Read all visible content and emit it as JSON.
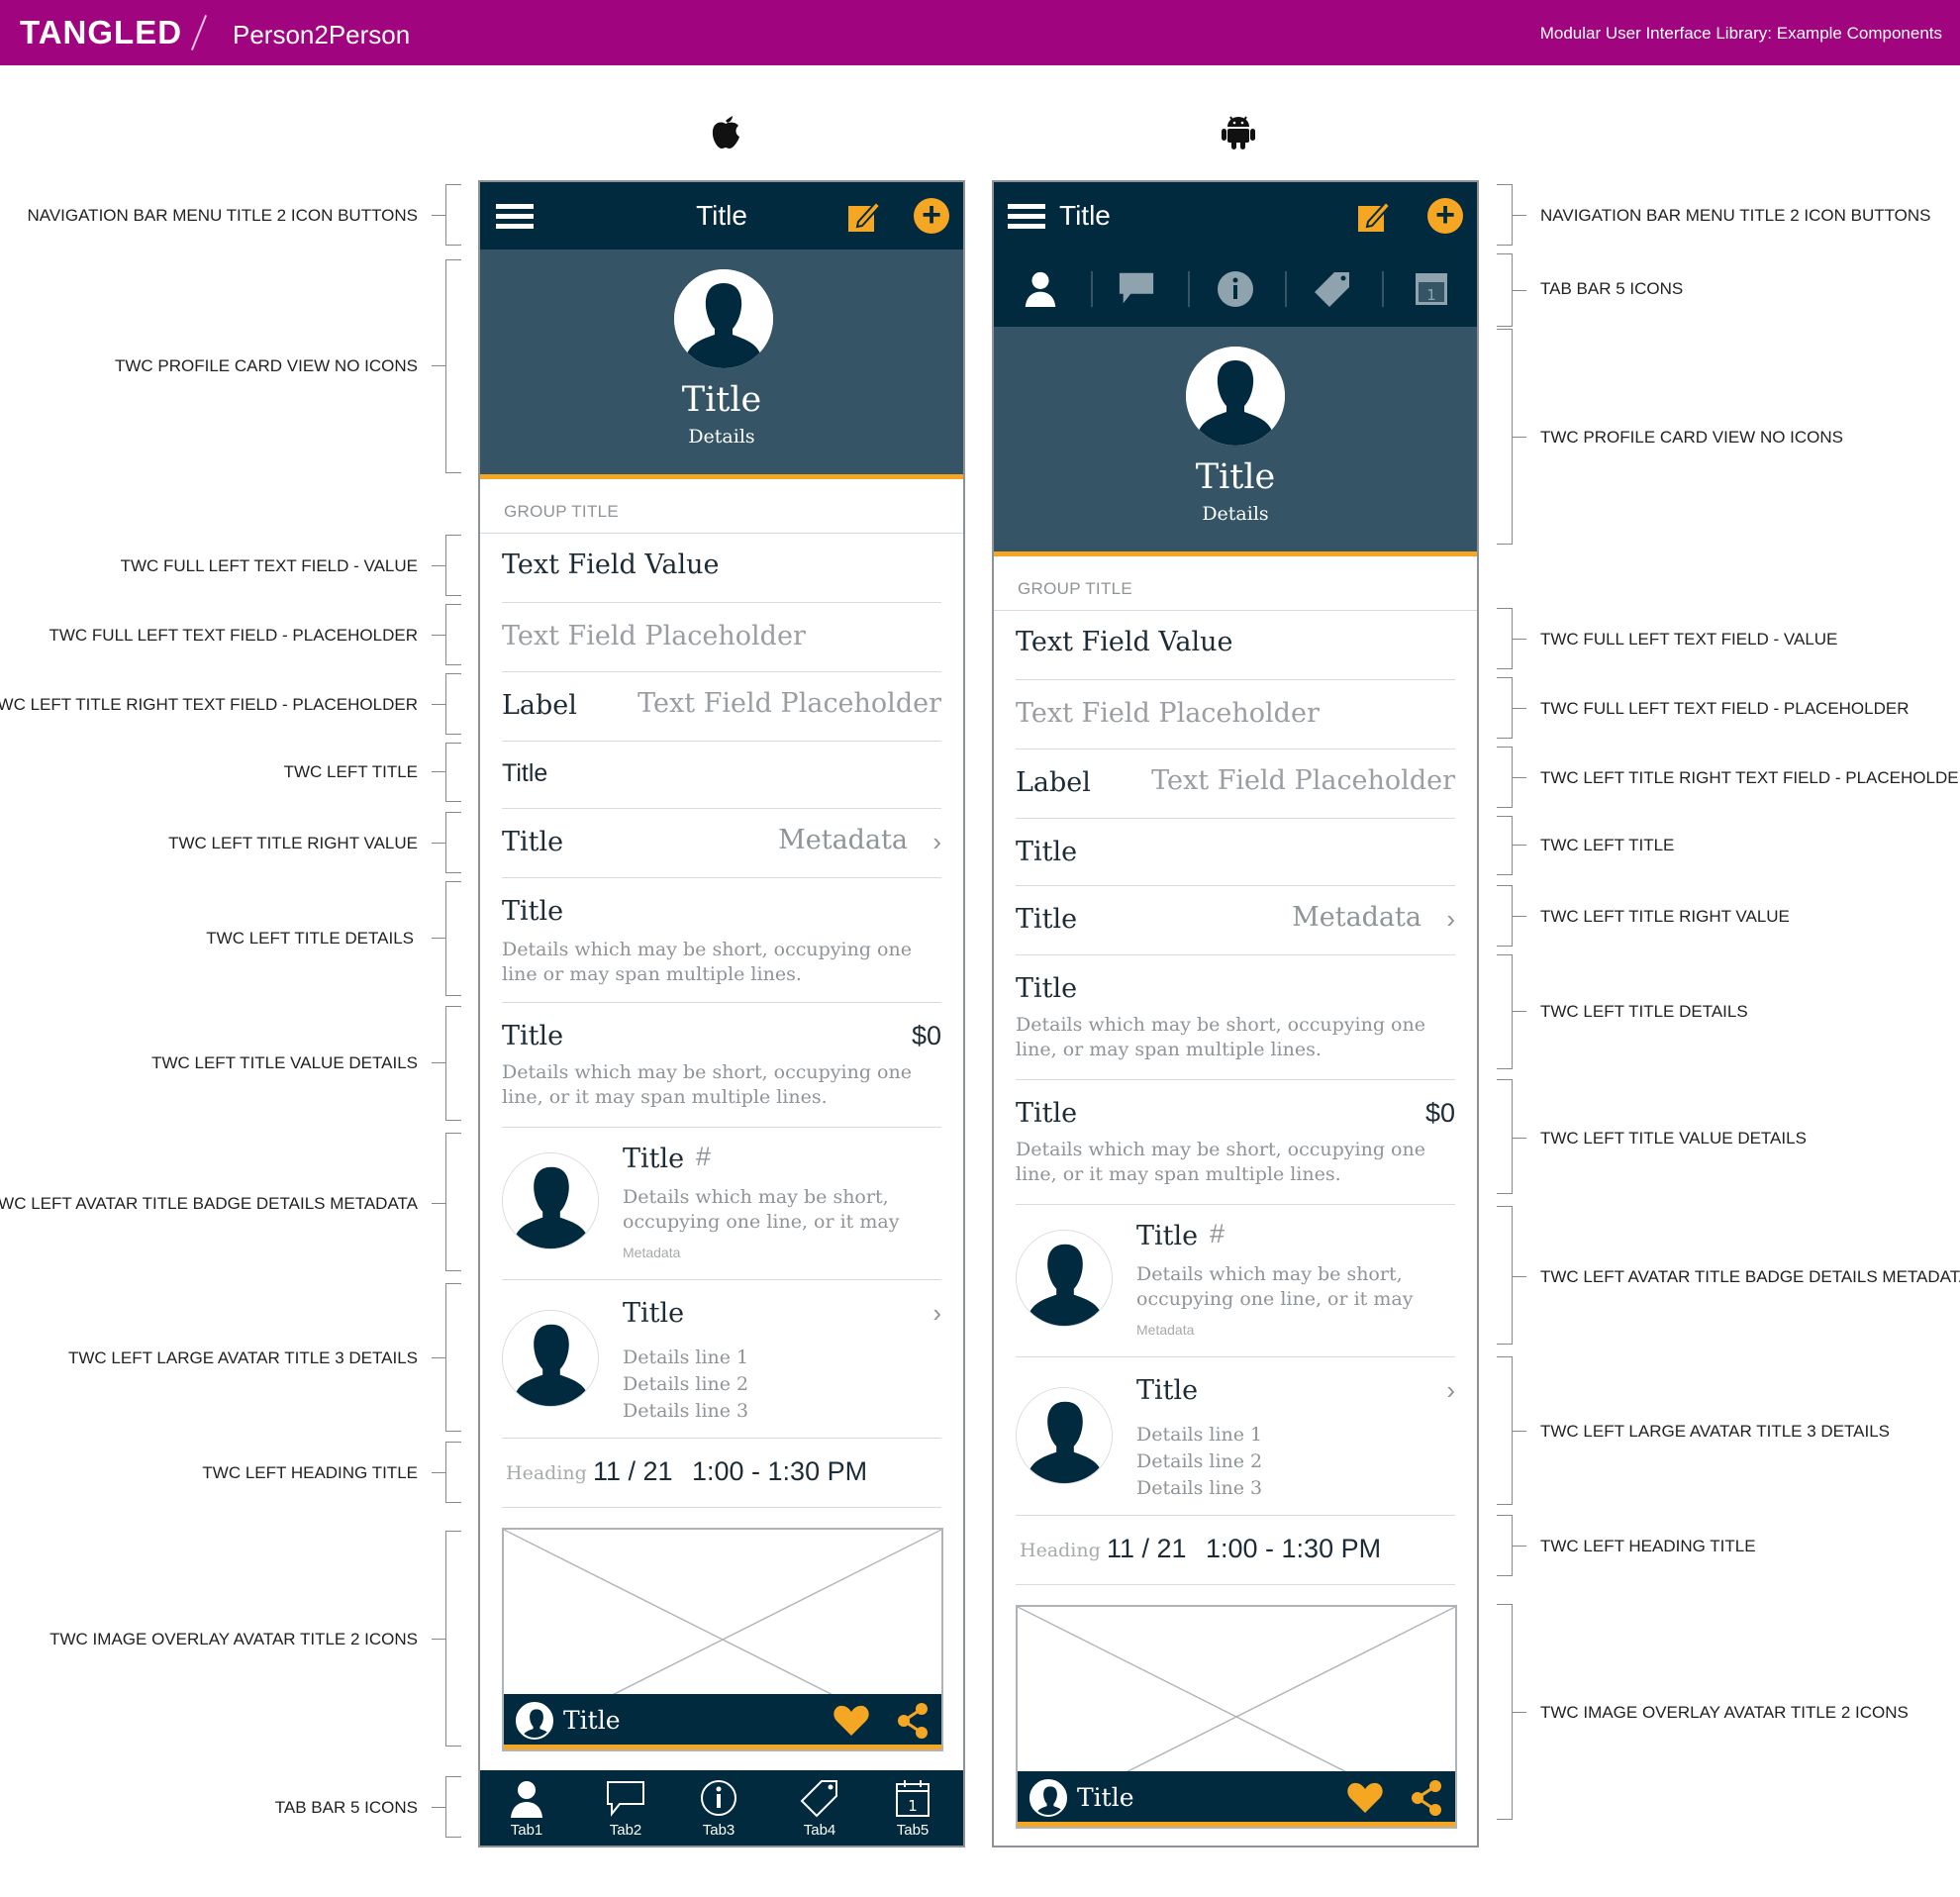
{
  "header": {
    "brand": "TANGLED",
    "product": "Person2Person",
    "library_title": "Modular User Interface Library: Example Components",
    "background": "#a0047e"
  },
  "platforms": {
    "ios_icon": "apple-icon",
    "android_icon": "android-icon"
  },
  "colors": {
    "navy": "#022a3e",
    "slate": "#355566",
    "accent": "#f5a623",
    "brand": "#a0047e"
  },
  "ios": {
    "nav_title": "Title",
    "profile_title": "Title",
    "profile_details": "Details",
    "group_title": "GROUP TITLE",
    "text_field_value": "Text Field Value",
    "text_field_placeholder": "Text Field Placeholder",
    "label": "Label",
    "label_placeholder": "Text Field Placeholder",
    "left_title": "Title",
    "rv_title": "Title",
    "rv_metadata": "Metadata",
    "td_title": "Title",
    "td_details": "Details which may be short, occupying one line or may span multiple lines.",
    "tvd_title": "Title",
    "tvd_value": "$0",
    "tvd_details": "Details which may be short, occupying one line, or it may span multiple lines.",
    "ab_title": "Title",
    "ab_badge": "#",
    "ab_details": "Details which may be short, occupying one line, or it may",
    "ab_metadata": "Metadata",
    "la_title": "Title",
    "la_line1": "Details line 1",
    "la_line2": "Details line 2",
    "la_line3": "Details line 3",
    "heading_label": "Heading",
    "heading_date": "11 / 21",
    "heading_time": "1:00 - 1:30 PM",
    "overlay_title": "Title",
    "tabs": [
      "Tab1",
      "Tab2",
      "Tab3",
      "Tab4",
      "Tab5"
    ]
  },
  "android": {
    "nav_title": "Title",
    "profile_title": "Title",
    "profile_details": "Details",
    "group_title": "GROUP TITLE",
    "text_field_value": "Text Field Value",
    "text_field_placeholder": "Text Field Placeholder",
    "label": "Label",
    "label_placeholder": "Text Field Placeholder",
    "left_title": "Title",
    "rv_title": "Title",
    "rv_metadata": "Metadata",
    "td_title": "Title",
    "td_details": "Details which may be short, occupying one line, or may span multiple lines.",
    "tvd_title": "Title",
    "tvd_value": "$0",
    "tvd_details": "Details which may be short, occupying one line, or it may span multiple lines.",
    "ab_title": "Title",
    "ab_badge": "#",
    "ab_details": "Details which may be short, occupying one line, or it may",
    "ab_metadata": "Metadata",
    "la_title": "Title",
    "la_line1": "Details line 1",
    "la_line2": "Details line 2",
    "la_line3": "Details line 3",
    "heading_label": "Heading",
    "heading_date": "11 / 21",
    "heading_time": "1:00 - 1:30 PM",
    "overlay_title": "Title"
  },
  "annotations_left": [
    "NAVIGATION BAR MENU TITLE 2 ICON BUTTONS",
    "TWC PROFILE CARD VIEW NO ICONS",
    "TWC FULL LEFT TEXT FIELD - VALUE",
    "TWC FULL LEFT TEXT FIELD - PLACEHOLDER",
    "TWC LEFT TITLE RIGHT TEXT FIELD - PLACEHOLDER",
    "TWC LEFT TITLE",
    "TWC LEFT TITLE RIGHT VALUE",
    "TWC LEFT TITLE DETAILS",
    "TWC LEFT TITLE VALUE DETAILS",
    "TWC LEFT AVATAR TITLE BADGE DETAILS METADATA",
    "TWC LEFT LARGE AVATAR TITLE 3 DETAILS",
    "TWC LEFT HEADING TITLE",
    "TWC IMAGE OVERLAY AVATAR TITLE 2 ICONS",
    "TAB BAR 5 ICONS"
  ],
  "annotations_right": [
    "NAVIGATION BAR MENU TITLE 2 ICON BUTTONS",
    "TAB BAR 5 ICONS",
    "TWC PROFILE CARD VIEW NO ICONS",
    "TWC FULL LEFT TEXT FIELD - VALUE",
    "TWC FULL LEFT TEXT FIELD - PLACEHOLDER",
    "TWC LEFT TITLE RIGHT TEXT FIELD - PLACEHOLDER",
    "TWC LEFT TITLE",
    "TWC LEFT TITLE RIGHT VALUE",
    "TWC LEFT TITLE DETAILS",
    "TWC LEFT TITLE VALUE DETAILS",
    "TWC LEFT AVATAR TITLE BADGE DETAILS METADATA",
    "TWC LEFT LARGE AVATAR TITLE 3 DETAILS",
    "TWC LEFT HEADING TITLE",
    "TWC IMAGE OVERLAY AVATAR TITLE 2 ICONS"
  ]
}
